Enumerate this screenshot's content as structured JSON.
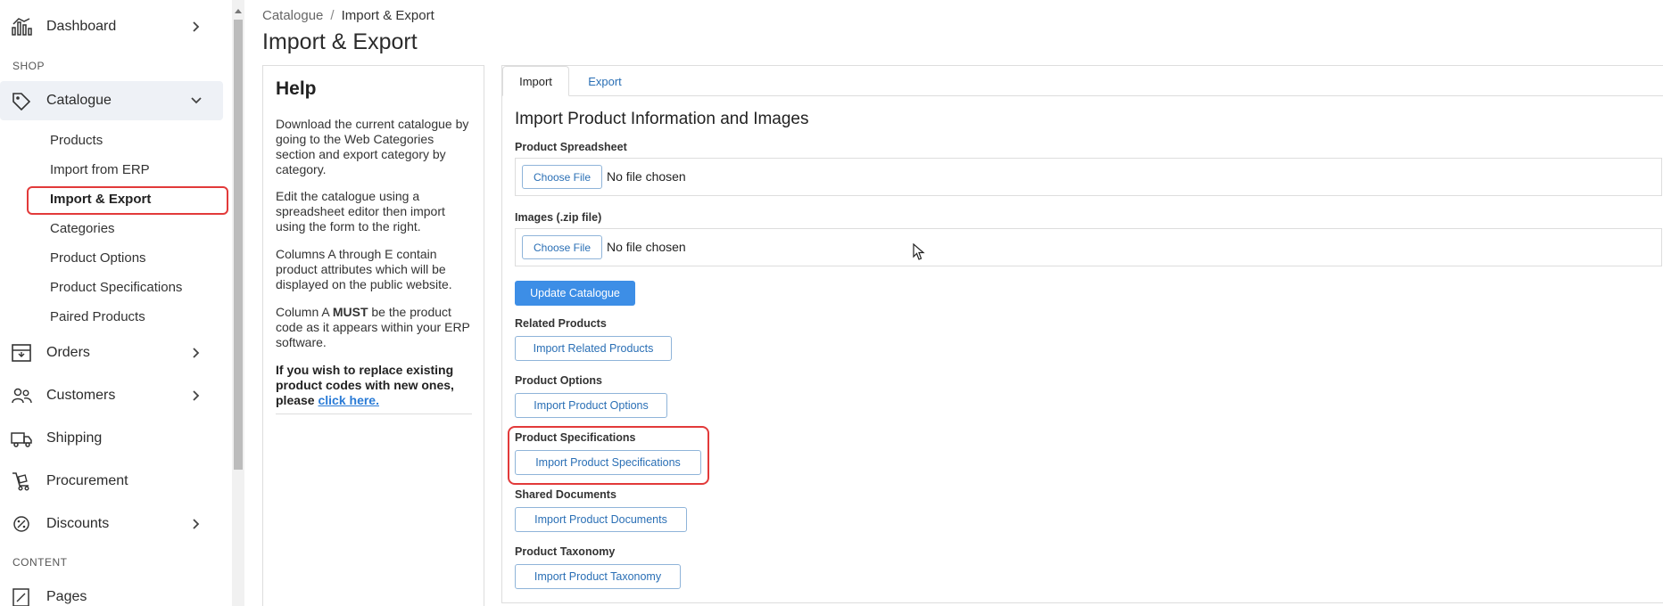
{
  "sidebar": {
    "items": [
      {
        "label": "Dashboard",
        "icon": "dashboard-icon"
      },
      {
        "label": "Catalogue",
        "icon": "tag-icon"
      },
      {
        "label": "Orders",
        "icon": "box-icon"
      },
      {
        "label": "Customers",
        "icon": "users-icon"
      },
      {
        "label": "Shipping",
        "icon": "truck-icon"
      },
      {
        "label": "Procurement",
        "icon": "trolley-icon"
      },
      {
        "label": "Discounts",
        "icon": "discount-icon"
      },
      {
        "label": "Pages",
        "icon": "page-icon"
      }
    ],
    "sections": {
      "shop": "SHOP",
      "content": "CONTENT"
    },
    "catalogue_sub": [
      "Products",
      "Import from ERP",
      "Import & Export",
      "Categories",
      "Product Options",
      "Product Specifications",
      "Paired Products"
    ]
  },
  "breadcrumb": {
    "parent": "Catalogue",
    "separator": "/",
    "current": "Import & Export"
  },
  "page_title": "Import & Export",
  "help": {
    "title": "Help",
    "p1": "Download the current catalogue by going to the Web Categories section and export category by category.",
    "p2": "Edit the catalogue using a spreadsheet editor then import using the form to the right.",
    "p3": "Columns A through E contain product attributes which will be displayed on the public website.",
    "p4_pre": "Column A ",
    "p4_bold": "MUST",
    "p4_post": " be the product code as it appears within your ERP software.",
    "p5_text": "If you wish to replace existing product codes with new ones, please ",
    "p5_link": "click here."
  },
  "tabs": {
    "import": "Import",
    "export": "Export"
  },
  "import_form": {
    "section_title": "Import Product Information and Images",
    "spreadsheet_label": "Product Spreadsheet",
    "images_label": "Images (.zip file)",
    "choose_file": "Choose File",
    "no_file": "No file chosen",
    "update_button": "Update Catalogue",
    "related_label": "Related Products",
    "related_button": "Import Related Products",
    "options_label": "Product Options",
    "options_button": "Import Product Options",
    "specs_label": "Product Specifications",
    "specs_button": "Import Product Specifications",
    "docs_label": "Shared Documents",
    "docs_button": "Import Product Documents",
    "taxonomy_label": "Product Taxonomy",
    "taxonomy_button": "Import Product Taxonomy"
  },
  "colors": {
    "accent": "#3d8ee6",
    "highlight": "#e23a3a",
    "link": "#2a6fb5"
  }
}
